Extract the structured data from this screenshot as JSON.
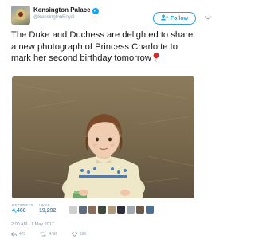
{
  "account": {
    "name": "Kensington Palace",
    "handle": "@KensingtonRoyal",
    "verified_icon": "verified-badge-icon"
  },
  "follow_button": {
    "label": "Follow",
    "icon": "add-person-icon",
    "accent": "#1da1f2"
  },
  "menu": {
    "icon": "chevron-down-icon"
  },
  "tweet": {
    "text": "The Duke and Duchess are delighted to share a new photograph of Princess Charlotte to mark her second birthday tomorrow",
    "emoji": "balloon-icon"
  },
  "photo": {
    "icon": "photo"
  },
  "stats": {
    "retweets_label": "RETWEETS",
    "retweets_value": "4,468",
    "likes_label": "LIKES",
    "likes_value": "19,292"
  },
  "timestamp": "2:00 AM - 1 May 2017",
  "actions": {
    "reply_count": "473",
    "retweet_count": "4.5K",
    "like_count": "19K"
  },
  "colors": {
    "text": "#14171a",
    "muted": "#8899a6",
    "accent": "#1da1f2"
  }
}
